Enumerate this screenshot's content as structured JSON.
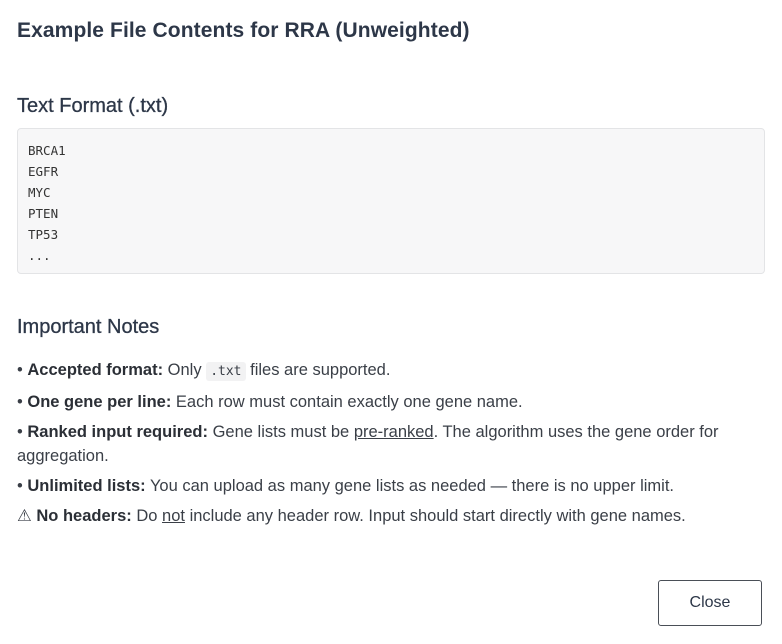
{
  "modal": {
    "title": "Example File Contents for RRA (Unweighted)",
    "close_label": "Close"
  },
  "format_section": {
    "title": "Text Format (.txt)",
    "lines": [
      "BRCA1",
      "EGFR",
      "MYC",
      "PTEN",
      "TP53",
      "..."
    ]
  },
  "notes_section": {
    "title": "Important Notes",
    "items": [
      {
        "bullet": "•",
        "label": "Accepted format:",
        "text_before": "Only",
        "code": ".txt",
        "text_after": "files are supported."
      },
      {
        "bullet": "•",
        "label": "One gene per line:",
        "text": "Each row must contain exactly one gene name."
      },
      {
        "bullet": "•",
        "label": "Ranked input required:",
        "text_before": "Gene lists must be",
        "underlined": "pre-ranked",
        "text_after": ". The algorithm uses the gene order for aggregation."
      },
      {
        "bullet": "•",
        "label": "Unlimited lists:",
        "text": "You can upload as many gene lists as needed — there is no upper limit."
      },
      {
        "bullet": "⚠",
        "label": "No headers:",
        "text_before": "Do",
        "underlined": "not",
        "text_after": "include any header row. Input should start directly with gene names."
      }
    ]
  }
}
